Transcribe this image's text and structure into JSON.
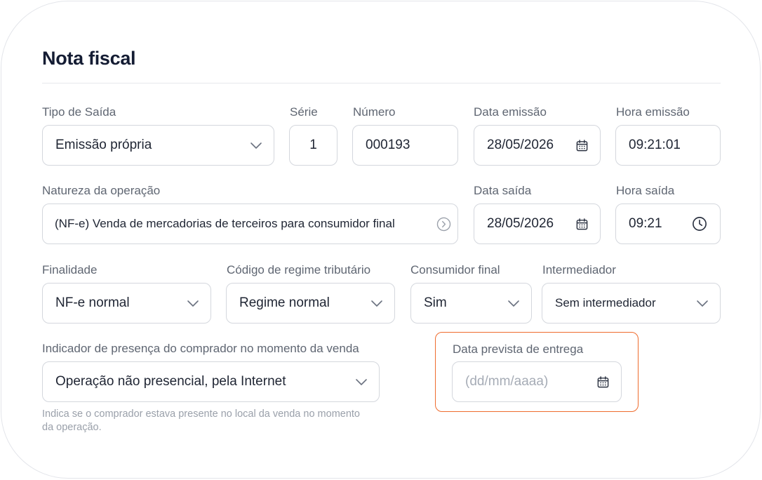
{
  "form": {
    "title": "Nota fiscal",
    "tipo_saida": {
      "label": "Tipo de Saída",
      "value": "Emissão própria"
    },
    "serie": {
      "label": "Série",
      "value": "1"
    },
    "numero": {
      "label": "Número",
      "value": "000193"
    },
    "data_emissao": {
      "label": "Data emissão",
      "value": "28/05/2026"
    },
    "hora_emissao": {
      "label": "Hora emissão",
      "value": "09:21:01"
    },
    "natureza_operacao": {
      "label": "Natureza da operação",
      "value": "(NF-e) Venda de mercadorias de terceiros para consumidor final"
    },
    "data_saida": {
      "label": "Data saída",
      "value": "28/05/2026"
    },
    "hora_saida": {
      "label": "Hora saída",
      "value": "09:21"
    },
    "finalidade": {
      "label": "Finalidade",
      "value": "NF-e normal"
    },
    "regime_tributario": {
      "label": "Código de regime tributário",
      "value": "Regime normal"
    },
    "consumidor_final": {
      "label": "Consumidor final",
      "value": "Sim"
    },
    "intermediador": {
      "label": "Intermediador",
      "value": "Sem intermediador"
    },
    "indicador_presenca": {
      "label": "Indicador de presença do comprador no momento da venda",
      "value": "Operação não presencial, pela Internet",
      "hint": "Indica se o comprador estava presente no local da venda no momento da operação."
    },
    "data_prevista_entrega": {
      "label": "Data prevista de entrega",
      "placeholder": "(dd/mm/aaaa)"
    }
  },
  "icons": {
    "dropdown": "chevron-down-icon",
    "date": "calendar-icon",
    "time": "clock-icon",
    "navigate": "chevron-right-circle-icon"
  },
  "colors": {
    "highlight_border": "#ef6c2e",
    "title": "#141c33",
    "label": "#5f6672",
    "placeholder": "#a6acb6"
  }
}
